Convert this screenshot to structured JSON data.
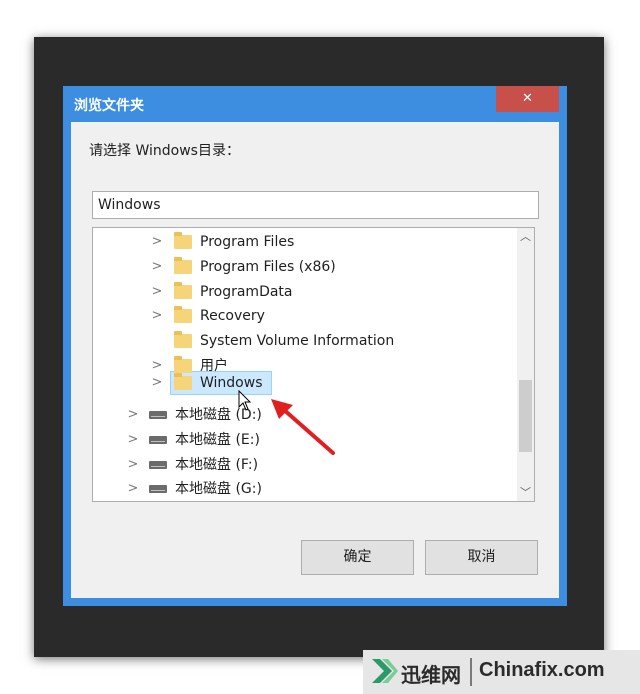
{
  "dialog": {
    "title": "浏览文件夹",
    "close_glyph": "✕",
    "prompt": "请选择 Windows目录：",
    "path_value": "Windows",
    "tree": [
      {
        "label": "Program Files",
        "icon": "folder-icon",
        "expandable": true
      },
      {
        "label": "Program Files (x86)",
        "icon": "folder-icon",
        "expandable": true
      },
      {
        "label": "ProgramData",
        "icon": "folder-icon",
        "expandable": true
      },
      {
        "label": "Recovery",
        "icon": "folder-icon",
        "expandable": true
      },
      {
        "label": "System Volume Information",
        "icon": "folder-icon",
        "expandable": false
      },
      {
        "label": "用户",
        "icon": "folder-icon",
        "expandable": true
      },
      {
        "label": "Windows",
        "icon": "folder-icon",
        "expandable": true,
        "selected": true
      },
      {
        "label": "本地磁盘 (D:)",
        "icon": "drive-icon",
        "expandable": true
      },
      {
        "label": "本地磁盘 (E:)",
        "icon": "drive-icon",
        "expandable": true
      },
      {
        "label": "本地磁盘 (F:)",
        "icon": "drive-icon",
        "expandable": true
      },
      {
        "label": "本地磁盘 (G:)",
        "icon": "drive-icon",
        "expandable": true
      }
    ],
    "expand_glyph": ">",
    "scroll_up_glyph": "︿",
    "scroll_down_glyph": "﹀",
    "ok_label": "确定",
    "cancel_label": "取消"
  },
  "watermark": {
    "cn_text": "迅维网",
    "en_text": "Chinafix.com"
  },
  "colors": {
    "titlebar": "#3d8ee0",
    "close": "#c7504b",
    "selection": "#cce8ff",
    "arrow": "#e02020"
  }
}
